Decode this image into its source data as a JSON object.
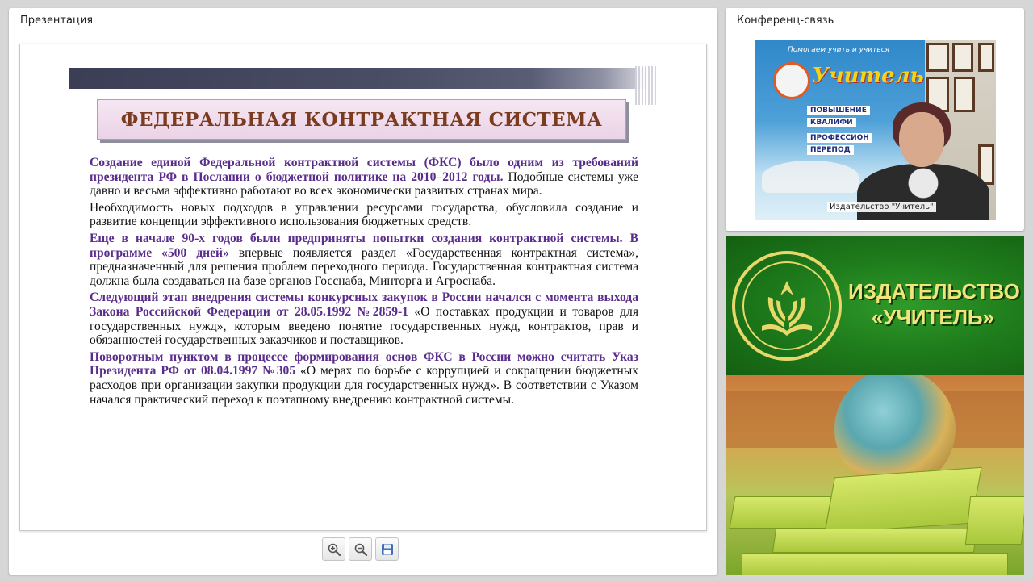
{
  "presentation": {
    "title": "Презентация",
    "slide": {
      "title": "ФЕДЕРАЛЬНАЯ КОНТРАКТНАЯ СИСТЕМА",
      "paragraphs": [
        {
          "bold": "Создание единой Федеральной контрактной системы (ФКС) было одним из требований президента РФ в Послании о бюджетной политике на 2010–2012 годы.",
          "plain": " Подобные системы уже давно и весьма эффективно работают во всех экономически развитых странах мира."
        },
        {
          "bold": "",
          "plain": "Необходимость новых подходов в управлении ресурсами государства, обусловила создание и развитие концепции эффективного использования бюджетных средств."
        },
        {
          "bold": "Еще в начале 90-х годов были предприняты попытки создания контрактной системы. В программе «500 дней»",
          "plain": " впервые появляется раздел «Государственная контрактная система», предназначенный для решения проблем переходного периода. Государственная контрактная система должна была создаваться на базе органов Госснаба, Минторга и Агроснаба."
        },
        {
          "bold": "Следующий этап внедрения системы конкурсных закупок в России начался с момента выхода Закона Российской Федерации от 28.05.1992 №2859-1",
          "plain": " «О поставках продукции и товаров для государственных нужд», которым введено понятие государственных нужд, контрактов, прав и обязанностей государственных заказчиков и поставщиков."
        },
        {
          "bold": "Поворотным пунктом в процессе формирования основ ФКС в России можно считать Указ Президента РФ от 08.04.1997 №305",
          "plain": " «О мерах по борьбе с коррупцией и сокращении бюджетных расходов при организации закупки продукции для государственных нужд». В соответствии с Указом начался практический переход к поэтапному внедрению контрактной системы."
        }
      ]
    },
    "toolbar": {
      "zoom_in_icon": "zoom-in-icon",
      "zoom_out_icon": "zoom-out-icon",
      "save_icon": "save-icon"
    }
  },
  "conference": {
    "title": "Конференц-связь",
    "participant_label": "Издательство \"Учитель\"",
    "banner": {
      "top_line": "Помогаем учить и учиться",
      "word": "Учитель",
      "line1": "ПОВЫШЕНИЕ",
      "line2": "КВАЛИФИ",
      "line3": "ПРОФЕССИОН",
      "line4": "ПЕРЕПОД"
    }
  },
  "brand": {
    "line1": "ИЗДАТЕЛЬСТВО",
    "line2": "«УЧИТЕЛЬ»"
  },
  "colors": {
    "highlight": "#5a2d8c",
    "slide_title": "#7a3b1e",
    "brand_green": "#1f7d1c",
    "brand_gold": "#f0e47a"
  }
}
